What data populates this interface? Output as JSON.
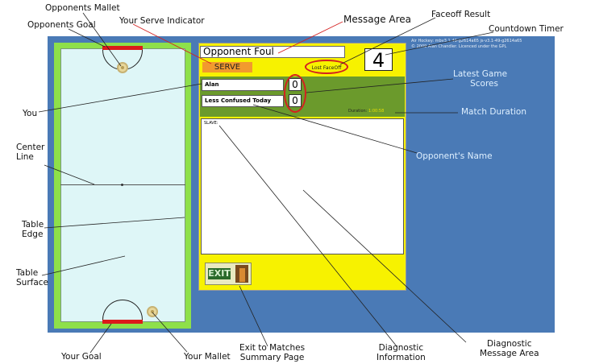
{
  "game": {
    "message": "Opponent Foul",
    "serve_label": "SERVE",
    "faceoff_result": "Lost FaceOff",
    "countdown": "4",
    "player_name": "Alan",
    "opponent_name": "Less Confused Today",
    "player_score": "0",
    "opponent_score": "0",
    "duration_label": "Duration:",
    "duration_value": "1:00:58",
    "diagnostic_text": "SLAVE:",
    "exit_label": "EXIT",
    "version_line1": "Air Hockey: mbv3.1-49-g2614a65 js-v3.1-49-g2614a65",
    "version_line2": "© 2009 Alan Chandler. Licenced under the GPL"
  },
  "annotations": {
    "opponents_mallet": "Opponents Mallet",
    "opponents_goal": "Opponents Goal",
    "serve_indicator": "Your Serve Indicator",
    "message_area": "Message Area",
    "faceoff_result": "Faceoff Result",
    "countdown_timer": "Countdown Timer",
    "latest_game_scores_1": "Latest Game",
    "latest_game_scores_2": "Scores",
    "match_duration": "Match Duration",
    "you": "You",
    "center_line_1": "Center",
    "center_line_2": "Line",
    "opponents_name": "Opponent's Name",
    "table_edge_1": "Table",
    "table_edge_2": "Edge",
    "table_surface_1": "Table",
    "table_surface_2": "Surface",
    "your_goal": "Your Goal",
    "your_mallet": "Your Mallet",
    "exit_1": "Exit to Matches",
    "exit_2": "Summary Page",
    "diag_info_1": "Diagnostic",
    "diag_info_2": "Information",
    "diag_area_1": "Diagnostic",
    "diag_area_2": "Message Area"
  },
  "colors": {
    "background_blue": "#4a7ab6",
    "panel_yellow": "#f7f200",
    "table_green": "#8ee04a",
    "goal_red": "#dc1a1a",
    "serve_orange": "#f29a2e",
    "score_green": "#6b9a2c"
  }
}
